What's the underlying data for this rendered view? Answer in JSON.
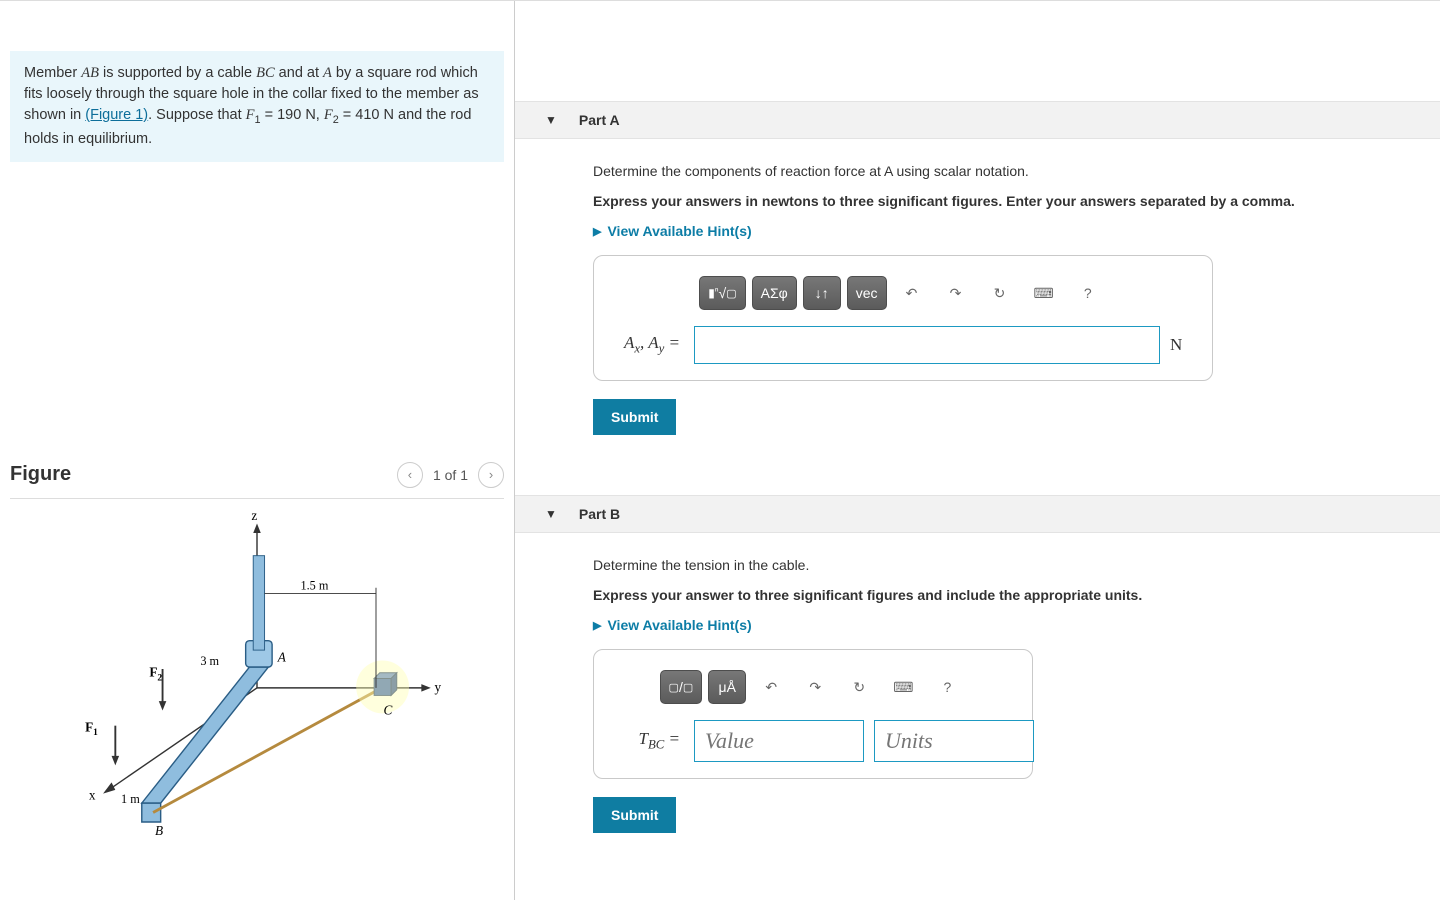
{
  "problem": {
    "text_pre": "Member ",
    "ab": "AB",
    "text_mid1": " is supported by a cable ",
    "bc": "BC",
    "text_mid2": " and at ",
    "a": "A",
    "text_mid3": " by a square rod which fits loosely through the square hole in the collar fixed to the member as shown in ",
    "figlink": "(Figure 1)",
    "text_mid4": ". Suppose that ",
    "f1": "F",
    "f1sub": "1",
    "f1eq": " = 190 N",
    "sep": ", ",
    "f2": "F",
    "f2sub": "2",
    "f2eq": " = 410 N",
    "text_end": " and the rod holds in equilibrium."
  },
  "figure": {
    "title": "Figure",
    "pager": "1 of 1",
    "labels": {
      "z": "z",
      "y": "y",
      "x": "x",
      "A": "A",
      "B": "B",
      "C": "C",
      "F1": "F",
      "F1sub": "1",
      "F2": "F",
      "F2sub": "2",
      "d1": "1.5 m",
      "d2": "3 m",
      "d3": "1 m"
    }
  },
  "partA": {
    "title": "Part A",
    "instr": "Determine the components of reaction force at A using scalar notation.",
    "bold": "Express your answers in newtons to three significant figures. Enter your answers separated by a comma.",
    "hints": "View Available Hint(s)",
    "toolbar": {
      "fraction": "▮√▢",
      "greek": "ΑΣφ",
      "updown": "↓↑",
      "vec": "vec",
      "undo": "↶",
      "redo": "↷",
      "reset": "↻",
      "keyboard": "⌨",
      "help": "?"
    },
    "label_lhs": "Aₓ, A_y =",
    "unit": "N",
    "submit": "Submit"
  },
  "partB": {
    "title": "Part B",
    "instr": "Determine the tension in the cable.",
    "bold": "Express your answer to three significant figures and include the appropriate units.",
    "hints": "View Available Hint(s)",
    "toolbar": {
      "fraction": "▮/▮",
      "units": "μÅ",
      "undo": "↶",
      "redo": "↷",
      "reset": "↻",
      "keyboard": "⌨",
      "help": "?"
    },
    "label_lhs": "T_BC =",
    "value_ph": "Value",
    "units_ph": "Units",
    "submit": "Submit"
  }
}
